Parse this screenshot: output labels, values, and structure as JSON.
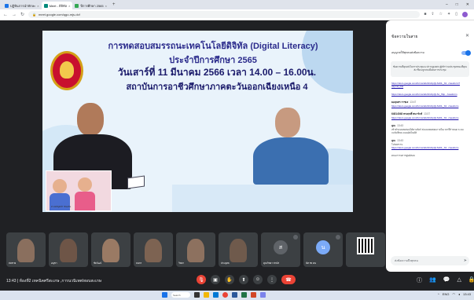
{
  "browser": {
    "tabs": [
      {
        "label": "ปฏิทินการนำทักษะ",
        "active": false
      },
      {
        "label": "Meet - ดิจิทัล",
        "active": true
      },
      {
        "label": "ปีการศึกษา 2565",
        "active": false
      }
    ],
    "url": "meet.google.com/qgo-mjs-dcf",
    "new_tab": "+"
  },
  "slide": {
    "title": "การทดสอบสมรรถนะเทคโนโลยีดิจิทัล (Digital Literacy)",
    "subtitle": "ประจำปีการศึกษา 2565",
    "date": "วันเสาร์ที่ 11 มีนาคม 2566 เวลา 14.00 – 16.00น.",
    "institute": "สถาบันการอาชีวศึกษาภาคตะวันออกเฉียงเหนือ 4",
    "caption": "ห องสมุดสา ขนเสน"
  },
  "participants": [
    {
      "name": "สมชาย",
      "type": "video"
    },
    {
      "name": "อนุชา",
      "type": "video"
    },
    {
      "name": "ชัยวัฒน์",
      "type": "video"
    },
    {
      "name": "ธนกร",
      "type": "video"
    },
    {
      "name": "วิทยา",
      "type": "video"
    },
    {
      "name": "ประยุทธ",
      "type": "video"
    },
    {
      "name": "คุณวิทยา สามัส",
      "type": "avatar",
      "initial": "ส"
    },
    {
      "name": "นัท 55 คน",
      "type": "avatar",
      "initial": "น"
    },
    {
      "name": "",
      "type": "qr"
    }
  ],
  "controls": {
    "time_meeting": "13:43 | ห้องที่2 เทคนิคศรีสะเกษ ,การนวนิเทศ/สอบสะเกษ",
    "buttons": [
      "mic",
      "camera",
      "raise-hand",
      "present",
      "emoji",
      "more",
      "end-call"
    ]
  },
  "panel": {
    "title": "ข้อความในสาย",
    "close": "✕",
    "toggle_label": "อนุญาตให้ทุกคนส่งข้อความ",
    "note": "ข้อความที่คุณส่งในการประชุมจะปรากฏเฉพาะผู้เข้าร่วมประชุมขณะที่คุณส่ง ซึ่งจะถูกลบเมื่อจบการประชุม",
    "messages": [
      {
        "who": "",
        "time": "",
        "text": "",
        "link": "https://docs.google.com/forms/d/e/1FAIpQLScDL_b3.../viewform?usp=sf_link"
      },
      {
        "who": "",
        "time": "",
        "text": "",
        "link": "https://docs.google.com/forms/d/e/1FAIpQLSc_hSp.../viewform"
      },
      {
        "who": "ผอสุนทร ราชเส",
        "time": "13:47",
        "text": "",
        "link": "https://docs.google.com/forms/d/e/1FAIpQLScDL_b3.../viewform"
      },
      {
        "who": "64814048 ทรงฤทธิ์ พนารักษ์",
        "time": "13:37",
        "text": "",
        "link": "https://docs.google.com/forms/d/e/1FAIpQLScDL_b3.../viewform"
      },
      {
        "who": "คุณ",
        "time": "13:43",
        "text": "เข้าทำแบบทดสอบได้ตามลิงก์ ส่งแบบทดสอบภายในเวลาที่กำหนด ระบบจะบันทึกคะแนนอัตโนมัติ",
        "link": ""
      },
      {
        "who": "คุณ",
        "time": "13:43",
        "text": "โปรดทราบ",
        "link": "https://docs.google.com/forms/d/e/1FAIpQLScDL_b3.../viewform"
      },
      {
        "who": "",
        "time": "",
        "text": "คณะกรรมการศูนย์สอบ",
        "link": ""
      }
    ],
    "input_placeholder": "ส่งข้อความถึงทุกคน",
    "send_icon": "send-icon"
  },
  "taskbar": {
    "search": "Search",
    "tray_time": "13:43",
    "tray_lang": "ENG"
  },
  "colors": {
    "meet_bg": "#202124",
    "accent": "#1a73e8",
    "end_call": "#ea4335",
    "slide_title": "#2b2b8c"
  }
}
